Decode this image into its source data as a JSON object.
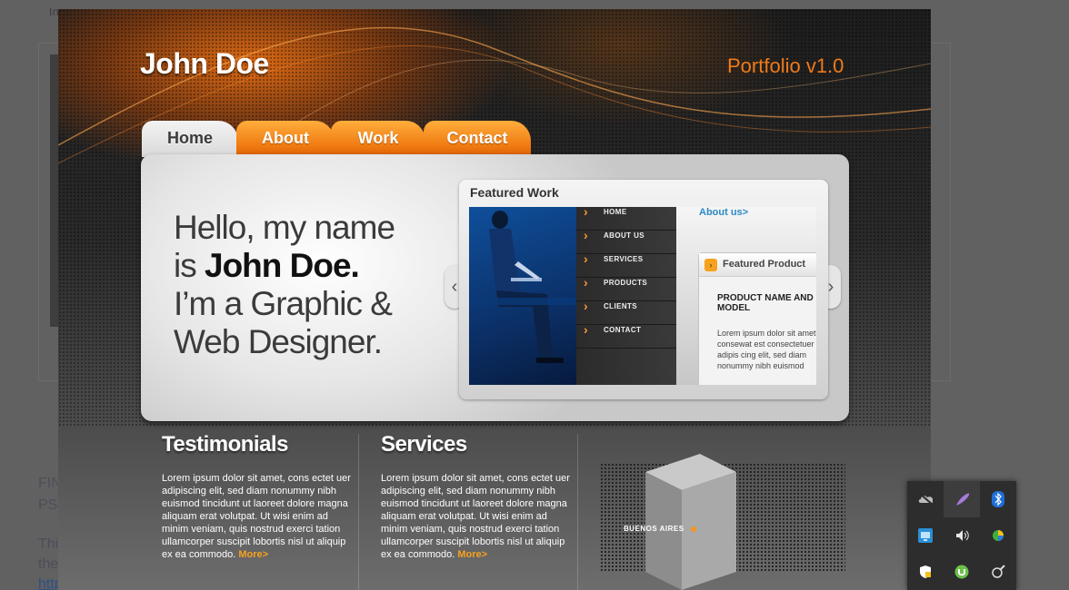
{
  "background_page": {
    "top_text": "In",
    "fin_lines": [
      "FIN",
      "PS"
    ],
    "this_lines": [
      "Thi",
      "the",
      "http"
    ]
  },
  "site": {
    "logo": "John Doe",
    "portfolio": "Portfolio v1.0",
    "tabs": [
      "Home",
      "About",
      "Work",
      "Contact"
    ],
    "active_tab": "Home",
    "hero": {
      "line1": "Hello, my name",
      "line2_prefix": "is ",
      "line2_name": "John Doe.",
      "line3": "I’m a Graphic &",
      "line4": "Web Designer."
    },
    "featured": {
      "title": "Featured Work",
      "menu": [
        "HOME",
        "ABOUT US",
        "SERVICES",
        "PRODUCTS",
        "CLIENTS",
        "CONTACT"
      ],
      "about_link": "About us>",
      "card_title": "Featured Product",
      "product_name": "PRODUCT NAME AND MODEL",
      "product_text": "Lorem ipsum dolor sit amet consewat est consectetuer adipis cing elit, sed diam nonummy nibh euismod"
    },
    "testimonials": {
      "title": "Testimonials",
      "text": "Lorem ipsum dolor sit amet, cons ectet uer adipiscing elit, sed diam nonummy nibh euismod tincidunt ut laoreet dolore magna aliquam erat volutpat. Ut wisi enim ad minim veniam, quis nostrud exerci tation ullamcorper suscipit lobortis nisl ut aliquip ex ea commodo.",
      "more": "More>"
    },
    "services": {
      "title": "Services",
      "text": "Lorem ipsum dolor sit amet, cons ectet uer adipiscing elit, sed diam nonummy nibh euismod tincidunt ut laoreet dolore magna aliquam erat volutpat. Ut wisi enim ad minim veniam, quis nostrud exerci tation ullamcorper suscipit lobortis nisl ut aliquip ex ea commodo.",
      "more": "More>"
    },
    "map_label": "BUENOS AIRES",
    "colors": {
      "accent": "#f07a1a",
      "link": "#2a89c6",
      "more": "#f7a21f"
    }
  },
  "tray": {
    "icons": [
      "onedrive-icon",
      "feather-icon",
      "bluetooth-icon",
      "network-icon",
      "volume-icon",
      "color-wheel-icon",
      "security-shield-icon",
      "utorrent-icon",
      "pen-tablet-icon"
    ]
  }
}
